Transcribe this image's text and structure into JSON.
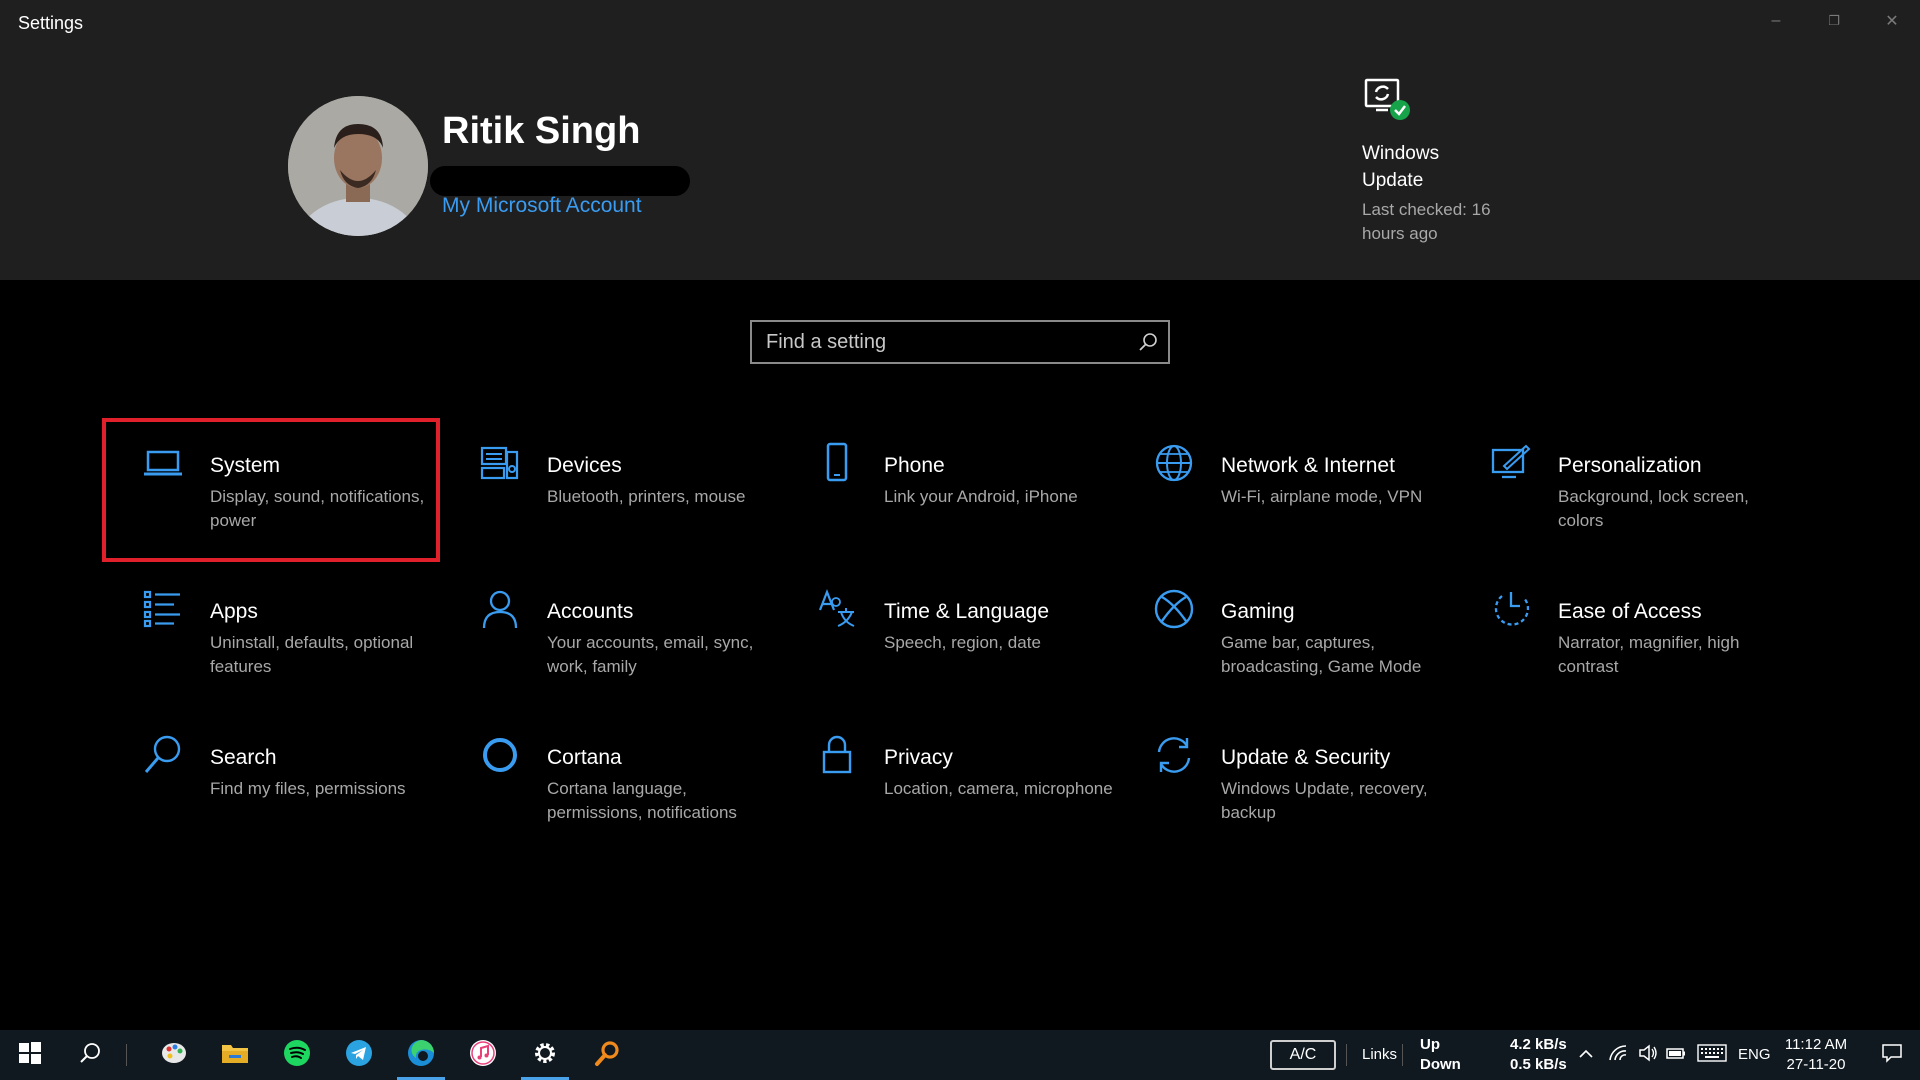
{
  "window": {
    "title": "Settings",
    "controls": {
      "minimize": "–",
      "restore": "❐",
      "close": "✕"
    }
  },
  "header": {
    "user_name": "Ritik Singh",
    "account_link": "My Microsoft Account",
    "windows_update": {
      "title": "Windows Update",
      "status": "Last checked: 16 hours ago"
    }
  },
  "search": {
    "placeholder": "Find a setting",
    "value": ""
  },
  "categories": [
    {
      "name": "System",
      "desc": "Display, sound, notifications, power",
      "icon": "laptop-icon",
      "selected": true
    },
    {
      "name": "Devices",
      "desc": "Bluetooth, printers, mouse",
      "icon": "keyboard-speaker-icon"
    },
    {
      "name": "Phone",
      "desc": "Link your Android, iPhone",
      "icon": "phone-icon"
    },
    {
      "name": "Network & Internet",
      "desc": "Wi-Fi, airplane mode, VPN",
      "icon": "globe-icon"
    },
    {
      "name": "Personalization",
      "desc": "Background, lock screen, colors",
      "icon": "pen-screen-icon"
    },
    {
      "name": "Apps",
      "desc": "Uninstall, defaults, optional features",
      "icon": "app-list-icon"
    },
    {
      "name": "Accounts",
      "desc": "Your accounts, email, sync, work, family",
      "icon": "person-icon"
    },
    {
      "name": "Time & Language",
      "desc": "Speech, region, date",
      "icon": "time-language-icon"
    },
    {
      "name": "Gaming",
      "desc": "Game bar, captures, broadcasting, Game Mode",
      "icon": "xbox-icon"
    },
    {
      "name": "Ease of Access",
      "desc": "Narrator, magnifier, high contrast",
      "icon": "ease-of-access-icon"
    },
    {
      "name": "Search",
      "desc": "Find my files, permissions",
      "icon": "magnifier-icon"
    },
    {
      "name": "Cortana",
      "desc": "Cortana language, permissions, notifications",
      "icon": "cortana-ring-icon"
    },
    {
      "name": "Privacy",
      "desc": "Location, camera, microphone",
      "icon": "lock-icon"
    },
    {
      "name": "Update & Security",
      "desc": "Windows Update, recovery, backup",
      "icon": "sync-arrows-icon"
    }
  ],
  "taskbar": {
    "ac_label": "A/C",
    "links_label": "Links",
    "net_up_label": "Up",
    "net_down_label": "Down",
    "net_up_speed": "4.2 kB/s",
    "net_down_speed": "0.5 kB/s",
    "language": "ENG",
    "time": "11:12 AM",
    "date": "27-11-20"
  },
  "colors": {
    "accent": "#3a9cf0",
    "selection_outline": "#e0202a",
    "header_bg": "#1f1f1f",
    "page_bg": "#000000",
    "secondary_text": "#a8a8a8"
  }
}
